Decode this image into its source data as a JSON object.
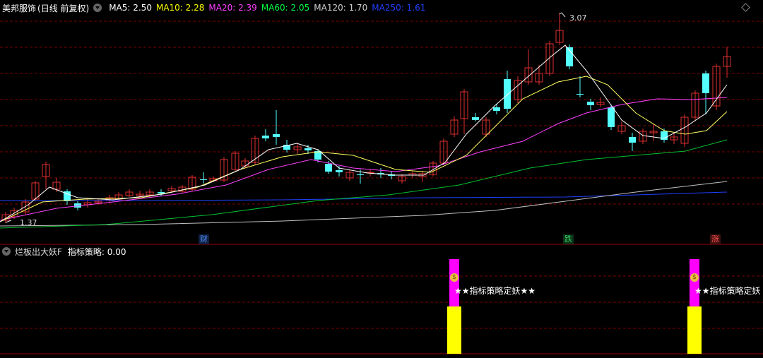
{
  "header": {
    "stock_name": "美邦服饰",
    "period_label": "(日线 前复权)",
    "ma": [
      {
        "label": "MA5: 2.50",
        "color": "#ffffff"
      },
      {
        "label": "MA10: 2.28",
        "color": "#ffff00"
      },
      {
        "label": "MA20: 2.39",
        "color": "#ff40ff"
      },
      {
        "label": "MA60: 2.05",
        "color": "#00ff40"
      },
      {
        "label": "MA120: 1.70",
        "color": "#d0d0d0"
      },
      {
        "label": "MA250: 1.61",
        "color": "#2040ff"
      }
    ]
  },
  "price_labels": {
    "high": "3.07",
    "low": "1.37"
  },
  "event_markers": [
    {
      "text": "财",
      "color": "#2060c0"
    },
    {
      "text": "跌",
      "color": "#00a040"
    },
    {
      "text": "涨",
      "color": "#c02020"
    }
  ],
  "sub_panel": {
    "indicator_name": "烂板出大妖F",
    "strategy_label": "指标策略: 0.00",
    "signal_text": "★★指标策略定妖★★",
    "signal_text_cut": "★★指标策略定妖"
  },
  "colors": {
    "up": "#e03030",
    "down": "#54ffff",
    "grid": "#7a0000",
    "signal_magenta": "#ff00ff",
    "signal_yellow": "#ffff00"
  }
}
